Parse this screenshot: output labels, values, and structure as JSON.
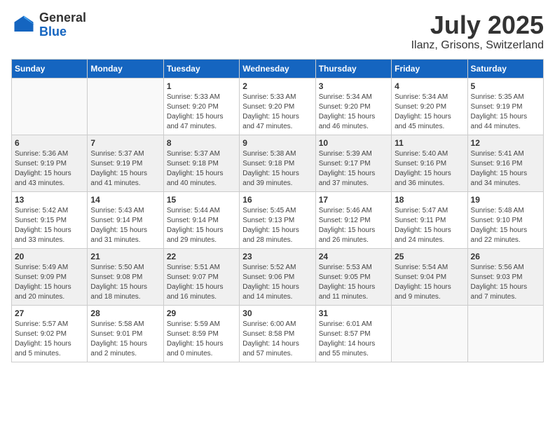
{
  "header": {
    "logo_general": "General",
    "logo_blue": "Blue",
    "title": "July 2025",
    "subtitle": "Ilanz, Grisons, Switzerland"
  },
  "days_of_week": [
    "Sunday",
    "Monday",
    "Tuesday",
    "Wednesday",
    "Thursday",
    "Friday",
    "Saturday"
  ],
  "weeks": [
    [
      {
        "day": "",
        "info": ""
      },
      {
        "day": "",
        "info": ""
      },
      {
        "day": "1",
        "info": "Sunrise: 5:33 AM\nSunset: 9:20 PM\nDaylight: 15 hours and 47 minutes."
      },
      {
        "day": "2",
        "info": "Sunrise: 5:33 AM\nSunset: 9:20 PM\nDaylight: 15 hours and 47 minutes."
      },
      {
        "day": "3",
        "info": "Sunrise: 5:34 AM\nSunset: 9:20 PM\nDaylight: 15 hours and 46 minutes."
      },
      {
        "day": "4",
        "info": "Sunrise: 5:34 AM\nSunset: 9:20 PM\nDaylight: 15 hours and 45 minutes."
      },
      {
        "day": "5",
        "info": "Sunrise: 5:35 AM\nSunset: 9:19 PM\nDaylight: 15 hours and 44 minutes."
      }
    ],
    [
      {
        "day": "6",
        "info": "Sunrise: 5:36 AM\nSunset: 9:19 PM\nDaylight: 15 hours and 43 minutes."
      },
      {
        "day": "7",
        "info": "Sunrise: 5:37 AM\nSunset: 9:19 PM\nDaylight: 15 hours and 41 minutes."
      },
      {
        "day": "8",
        "info": "Sunrise: 5:37 AM\nSunset: 9:18 PM\nDaylight: 15 hours and 40 minutes."
      },
      {
        "day": "9",
        "info": "Sunrise: 5:38 AM\nSunset: 9:18 PM\nDaylight: 15 hours and 39 minutes."
      },
      {
        "day": "10",
        "info": "Sunrise: 5:39 AM\nSunset: 9:17 PM\nDaylight: 15 hours and 37 minutes."
      },
      {
        "day": "11",
        "info": "Sunrise: 5:40 AM\nSunset: 9:16 PM\nDaylight: 15 hours and 36 minutes."
      },
      {
        "day": "12",
        "info": "Sunrise: 5:41 AM\nSunset: 9:16 PM\nDaylight: 15 hours and 34 minutes."
      }
    ],
    [
      {
        "day": "13",
        "info": "Sunrise: 5:42 AM\nSunset: 9:15 PM\nDaylight: 15 hours and 33 minutes."
      },
      {
        "day": "14",
        "info": "Sunrise: 5:43 AM\nSunset: 9:14 PM\nDaylight: 15 hours and 31 minutes."
      },
      {
        "day": "15",
        "info": "Sunrise: 5:44 AM\nSunset: 9:14 PM\nDaylight: 15 hours and 29 minutes."
      },
      {
        "day": "16",
        "info": "Sunrise: 5:45 AM\nSunset: 9:13 PM\nDaylight: 15 hours and 28 minutes."
      },
      {
        "day": "17",
        "info": "Sunrise: 5:46 AM\nSunset: 9:12 PM\nDaylight: 15 hours and 26 minutes."
      },
      {
        "day": "18",
        "info": "Sunrise: 5:47 AM\nSunset: 9:11 PM\nDaylight: 15 hours and 24 minutes."
      },
      {
        "day": "19",
        "info": "Sunrise: 5:48 AM\nSunset: 9:10 PM\nDaylight: 15 hours and 22 minutes."
      }
    ],
    [
      {
        "day": "20",
        "info": "Sunrise: 5:49 AM\nSunset: 9:09 PM\nDaylight: 15 hours and 20 minutes."
      },
      {
        "day": "21",
        "info": "Sunrise: 5:50 AM\nSunset: 9:08 PM\nDaylight: 15 hours and 18 minutes."
      },
      {
        "day": "22",
        "info": "Sunrise: 5:51 AM\nSunset: 9:07 PM\nDaylight: 15 hours and 16 minutes."
      },
      {
        "day": "23",
        "info": "Sunrise: 5:52 AM\nSunset: 9:06 PM\nDaylight: 15 hours and 14 minutes."
      },
      {
        "day": "24",
        "info": "Sunrise: 5:53 AM\nSunset: 9:05 PM\nDaylight: 15 hours and 11 minutes."
      },
      {
        "day": "25",
        "info": "Sunrise: 5:54 AM\nSunset: 9:04 PM\nDaylight: 15 hours and 9 minutes."
      },
      {
        "day": "26",
        "info": "Sunrise: 5:56 AM\nSunset: 9:03 PM\nDaylight: 15 hours and 7 minutes."
      }
    ],
    [
      {
        "day": "27",
        "info": "Sunrise: 5:57 AM\nSunset: 9:02 PM\nDaylight: 15 hours and 5 minutes."
      },
      {
        "day": "28",
        "info": "Sunrise: 5:58 AM\nSunset: 9:01 PM\nDaylight: 15 hours and 2 minutes."
      },
      {
        "day": "29",
        "info": "Sunrise: 5:59 AM\nSunset: 8:59 PM\nDaylight: 15 hours and 0 minutes."
      },
      {
        "day": "30",
        "info": "Sunrise: 6:00 AM\nSunset: 8:58 PM\nDaylight: 14 hours and 57 minutes."
      },
      {
        "day": "31",
        "info": "Sunrise: 6:01 AM\nSunset: 8:57 PM\nDaylight: 14 hours and 55 minutes."
      },
      {
        "day": "",
        "info": ""
      },
      {
        "day": "",
        "info": ""
      }
    ]
  ]
}
